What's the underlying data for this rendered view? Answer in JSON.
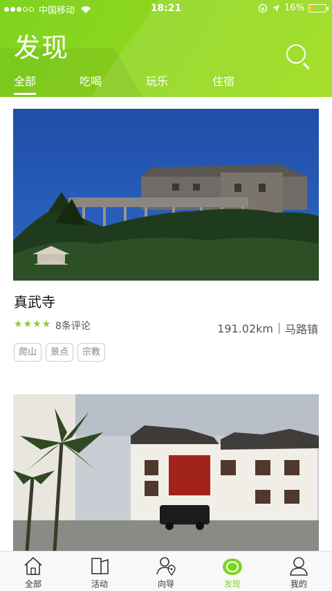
{
  "status_bar": {
    "carrier": "中国移动",
    "time": "18:21",
    "battery": "16%",
    "battery_level": 0.16
  },
  "header": {
    "title": "发现",
    "tabs": [
      {
        "label": "全部",
        "active": true
      },
      {
        "label": "吃喝",
        "active": false
      },
      {
        "label": "玩乐",
        "active": false
      },
      {
        "label": "住宿",
        "active": false
      }
    ]
  },
  "cards": [
    {
      "title": "真武寺",
      "rating": 4,
      "reviews": "8条评论",
      "distance": "191.02km",
      "location": "马路镇",
      "tags": [
        "爬山",
        "景点",
        "宗教"
      ]
    }
  ],
  "bottom_nav": [
    {
      "label": "全部",
      "icon": "home-icon",
      "active": false
    },
    {
      "label": "活动",
      "icon": "activity-icon",
      "active": false
    },
    {
      "label": "向导",
      "icon": "guide-icon",
      "active": false
    },
    {
      "label": "发现",
      "icon": "discover-icon",
      "active": true
    },
    {
      "label": "我的",
      "icon": "profile-icon",
      "active": false
    }
  ],
  "colors": {
    "accent": "#7ed321",
    "star": "#7ed321"
  }
}
